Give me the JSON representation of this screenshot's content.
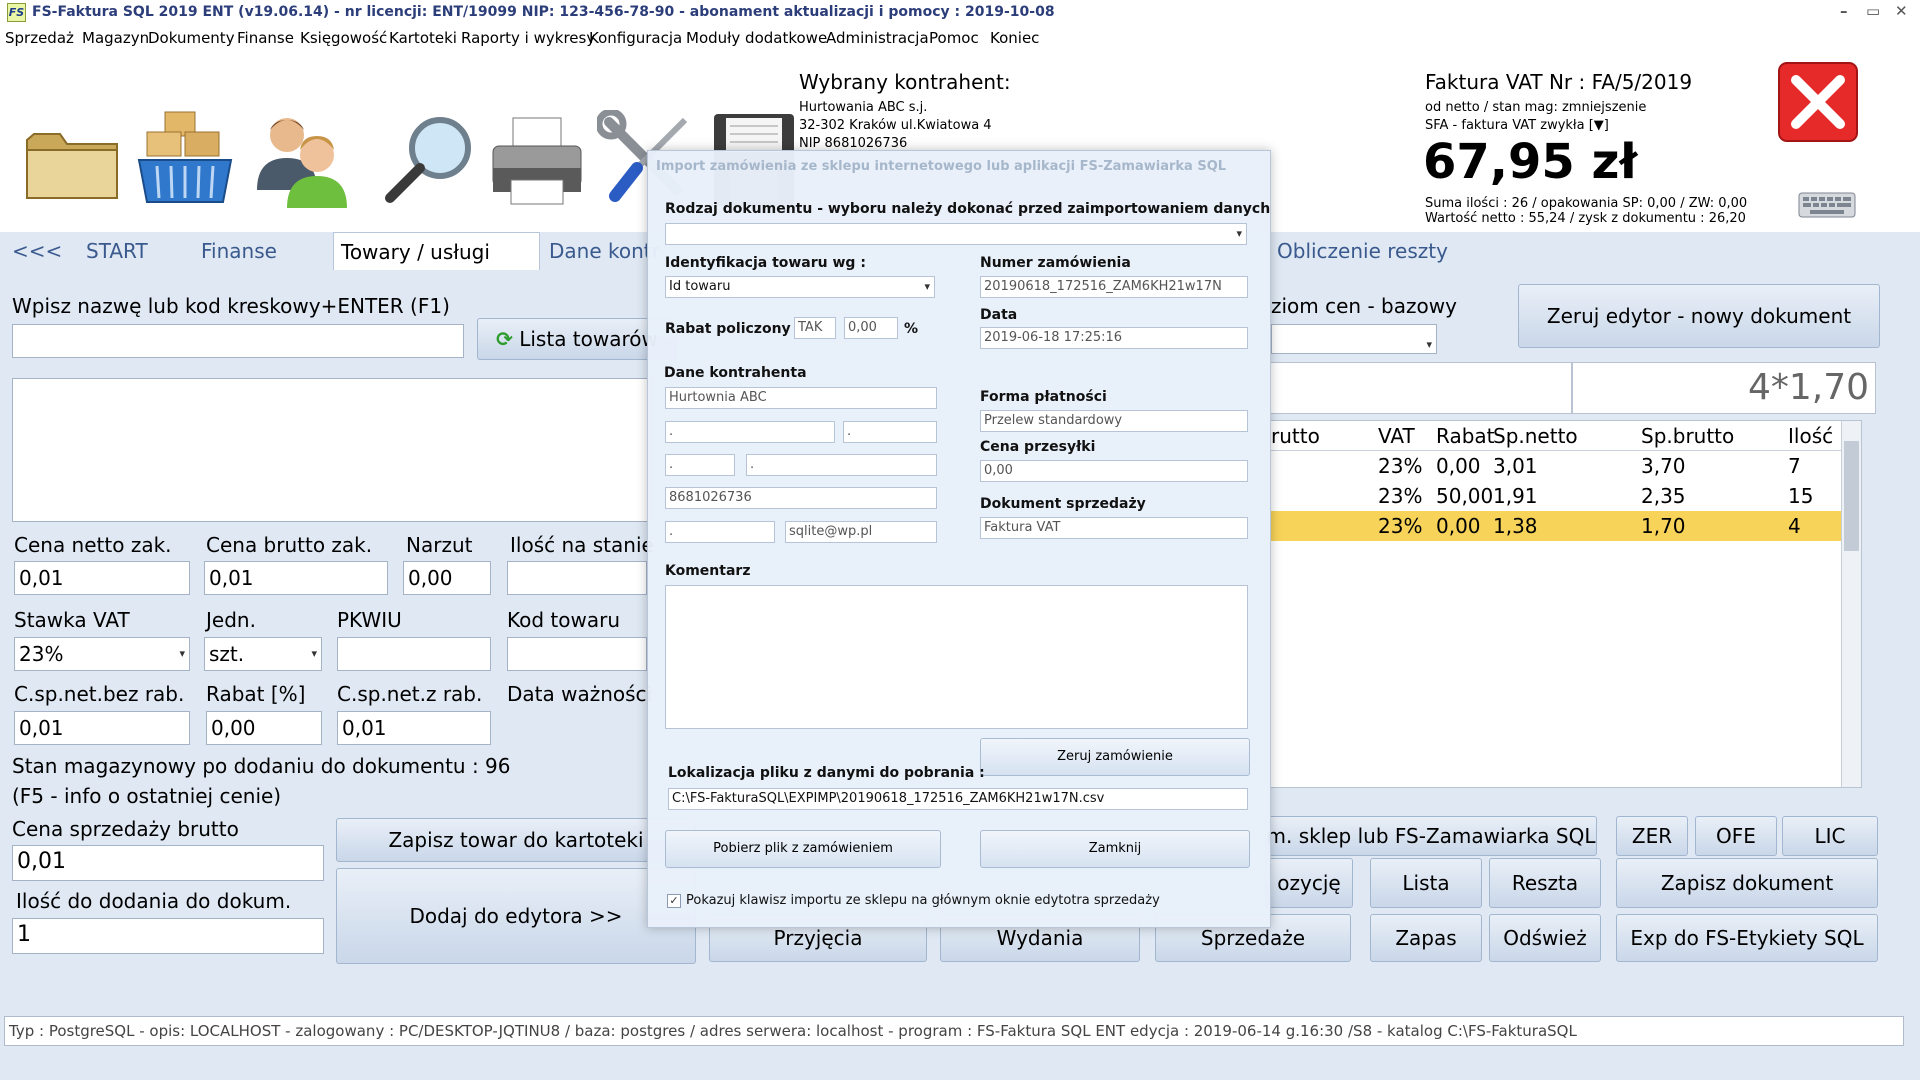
{
  "window": {
    "title": "FS-Faktura SQL 2019 ENT (v19.06.14)   -   nr licencji: ENT/19099   NIP: 123-456-78-90   -   abonament aktualizacji i pomocy :  2019-10-08",
    "icon_text": "FS",
    "controls": [
      "–",
      "▭",
      "✕"
    ]
  },
  "menu": [
    "Sprzedaż",
    "Magazyn",
    "Dokumenty",
    "Finanse",
    "Księgowość",
    "Kartoteki",
    "Raporty i wykresy",
    "Konfiguracja",
    "Moduły dodatkowe",
    "Administracja",
    "Pomoc",
    "Koniec"
  ],
  "toolbar": {
    "icons": [
      "folder-icon",
      "warehouse-basket-icon",
      "contractors-icon",
      "search-magnifier-icon",
      "printer-icon",
      "tools-icon",
      "save-floppy-icon"
    ]
  },
  "contractor": {
    "heading": "Wybrany kontrahent:",
    "name": "Hurtowania ABC s.j.",
    "address": "32-302 Kraków ul.Kwiatowa  4",
    "nip": "NIP 8681026736"
  },
  "invoice": {
    "title": "Faktura VAT Nr :  FA/5/2019",
    "mode": "od netto / stan mag: zmniejszenie",
    "type": "SFA - faktura VAT zwykła [▼]",
    "total": "67,95 zł",
    "summary1": "Suma ilości : 26 / opakowania SP: 0,00 / ZW: 0,00",
    "summary2": "Wartość netto : 55,24  / zysk z dokumentu : 26,20"
  },
  "tabs": [
    "<<<",
    "START",
    "Finanse",
    "Towary  / usługi",
    "Dane kontr",
    "Obliczenie reszty"
  ],
  "left": {
    "search_label": "Wpisz nazwę lub kod kreskowy+ENTER (F1)",
    "search_value": "",
    "list_button": "Lista towarów",
    "price_net_label": "Cena netto zak.",
    "price_net": "0,01",
    "price_gross_label": "Cena brutto zak.",
    "price_gross": "0,01",
    "markup_label": "Narzut",
    "markup": "0,00",
    "stock_label": "Ilość na stanie",
    "vat_label": "Stawka VAT",
    "vat": "23%",
    "unit_label": "Jedn.",
    "unit": "szt.",
    "pkwiu_label": "PKWIU",
    "code_label": "Kod towaru",
    "net_no_disc_label": "C.sp.net.bez rab.",
    "net_no_disc": "0,01",
    "disc_label": "Rabat [%]",
    "disc": "0,00",
    "net_disc_label": "C.sp.net.z rab.",
    "net_disc": "0,01",
    "expiry_label": "Data ważności",
    "stock_after": "Stan magazynowy po dodaniu do dokumentu : 96",
    "f5_info": "(F5 - info o ostatniej cenie)",
    "sale_gross_label": "Cena sprzedaży brutto",
    "sale_gross": "0,01",
    "qty_label": "Ilość do dodania do dokum.",
    "qty": "1",
    "save_product_btn": "Zapisz towar do kartoteki",
    "add_to_editor_btn": "Dodaj do edytora     >>"
  },
  "right": {
    "price_level_label": "ziom cen - bazowy",
    "reset_editor_btn": "Zeruj edytor -  nowy dokument",
    "calc_display": "4*1,70",
    "grid_headers": [
      "rutto",
      "VAT",
      "Rabat",
      "Sp.netto",
      "Sp.brutto",
      "Ilość"
    ],
    "grid_rows": [
      [
        "",
        "23%",
        "0,00",
        "3,01",
        "3,70",
        "7"
      ],
      [
        "",
        "23%",
        "50,00",
        "1,91",
        "2,35",
        "15"
      ],
      [
        "",
        "23%",
        "0,00",
        "1,38",
        "1,70",
        "4"
      ]
    ],
    "selected_row_color": "#f7d35a",
    "import_shop_btn": "m. sklep lub FS-Zamawiarka SQL",
    "zer_btn": "ZER",
    "ofe_btn": "OFE",
    "lic_btn": "LIC",
    "position_btn": "ozycję",
    "lista_btn": "Lista",
    "reszta_btn": "Reszta",
    "save_doc_btn": "Zapisz dokument",
    "przyjecia_btn": "Przyjęcia",
    "wydania_btn": "Wydania",
    "sprzedaze_btn": "Sprzedaże",
    "zapas_btn": "Zapas",
    "odswiez_btn": "Odśwież",
    "exp_btn": "Exp do FS-Etykiety SQL"
  },
  "status_bar": "Typ : PostgreSQL - opis: LOCALHOST  -  zalogowany : PC/DESKTOP-JQTINU8  / baza: postgres / adres serwera: localhost  -  program :  FS-Faktura SQL ENT edycja : 2019-06-14 g.16:30 /S8 - katalog C:\\FS-FakturaSQL",
  "dialog": {
    "title": "Import zamówienia ze sklepu internetowego lub aplikacji FS-Zamawiarka SQL",
    "doc_type_label": "Rodzaj dokumentu - wyboru należy dokonać przed zaimportowaniem danych",
    "doc_type_value": "",
    "ident_label": "Identyfikacja towaru wg :",
    "ident_value": "Id towaru",
    "order_no_label": "Numer zamówienia",
    "order_no": "20190618_172516_ZAM6KH21w17N",
    "discount_label": "Rabat policzony :",
    "discount_flag": "TAK",
    "discount_value": "0,00",
    "discount_unit": "%",
    "date_label": "Data",
    "date": "2019-06-18 17:25:16",
    "contractor_label": "Dane kontrahenta",
    "c_name": "Hurtownia ABC",
    "c_f2": ".",
    "c_f3": ".",
    "c_f4": ".",
    "c_f5": ".",
    "c_nip": "8681026736",
    "c_f7": ".",
    "c_email": "sqlite@wp.pl",
    "payment_label": "Forma płatności",
    "payment": "Przelew standardowy",
    "shipping_label": "Cena przesyłki",
    "shipping": "0,00",
    "sale_doc_label": "Dokument sprzedaży",
    "sale_doc": "Faktura VAT",
    "comment_label": "Komentarz",
    "comment": "",
    "reset_order_btn": "Zeruj zamówienie",
    "file_label": "Lokalizacja pliku z danymi do pobrania :",
    "file_path": "C:\\FS-FakturaSQL\\EXPIMP\\20190618_172516_ZAM6KH21w17N.csv",
    "download_btn": "Pobierz plik z zamówieniem",
    "close_btn": "Zamknij",
    "show_button_checkbox": "Pokazuj klawisz importu ze sklepu na głównym oknie edytotra sprzedaży",
    "show_button_checked": true
  }
}
